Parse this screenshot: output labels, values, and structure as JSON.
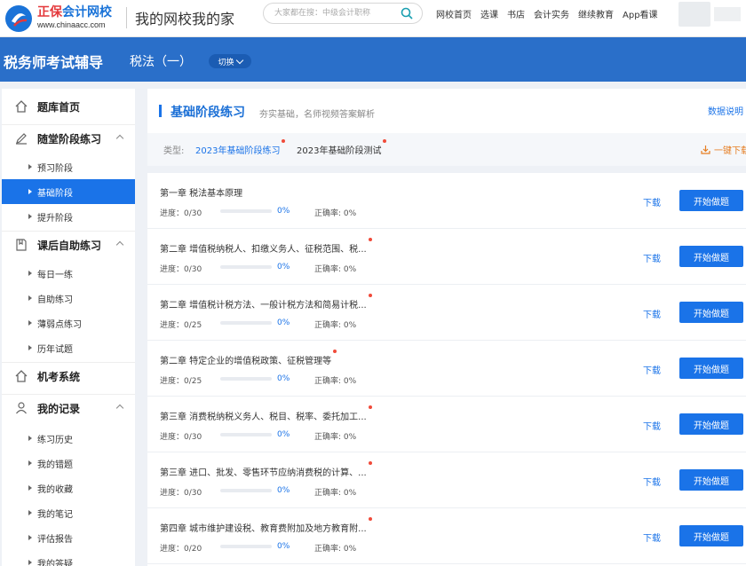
{
  "header": {
    "logo_brand": "正保",
    "logo_name": "会计网校",
    "logo_url": "www.chinaacc.com",
    "slogan": "我的网校我的家",
    "search_placeholder": "大家都在搜：中级会计职称",
    "nav": [
      "网校首页",
      "选课",
      "书店",
      "会计实务",
      "继续教育",
      "App看课"
    ]
  },
  "banner": {
    "title": "税务师考试辅导",
    "subject": "税法（一）",
    "switch_label": "切换"
  },
  "sidebar": {
    "groups": [
      {
        "label": "题库首页",
        "icon": "home-icon"
      },
      {
        "label": "随堂阶段练习",
        "icon": "pen-icon",
        "items": [
          "预习阶段",
          "基础阶段",
          "提升阶段"
        ]
      },
      {
        "label": "课后自助练习",
        "icon": "book-icon",
        "items": [
          "每日一练",
          "自助练习",
          "薄弱点练习",
          "历年试题"
        ]
      },
      {
        "label": "机考系统",
        "icon": "home-icon"
      },
      {
        "label": "我的记录",
        "icon": "user-icon",
        "items": [
          "练习历史",
          "我的错题",
          "我的收藏",
          "我的笔记",
          "评估报告",
          "我的答疑"
        ]
      }
    ],
    "active_item": "基础阶段"
  },
  "main": {
    "title": "基础阶段练习",
    "subtitle": "夯实基础，名师视频答案解析",
    "help": "数据说明",
    "type_label": "类型:",
    "types": [
      "2023年基础阶段练习",
      "2023年基础阶段测试"
    ],
    "download_all": "一键下载",
    "progress_label": "进度：",
    "accuracy_label": "正确率: ",
    "download_label": "下载",
    "start_label": "开始做题"
  },
  "rows": [
    {
      "title": "第一章 税法基本原理",
      "progress": "0/30",
      "percent": "0%",
      "accuracy": "0%",
      "new": false
    },
    {
      "title": "第二章 增值税纳税人、扣缴义务人、征税范围、税...",
      "progress": "0/30",
      "percent": "0%",
      "accuracy": "0%",
      "new": true
    },
    {
      "title": "第二章 增值税计税方法、一般计税方法和简易计税...",
      "progress": "0/25",
      "percent": "0%",
      "accuracy": "0%",
      "new": true
    },
    {
      "title": "第二章 特定企业的增值税政策、征税管理等",
      "progress": "0/25",
      "percent": "0%",
      "accuracy": "0%",
      "new": true
    },
    {
      "title": "第三章 消费税纳税义务人、税目、税率、委托加工...",
      "progress": "0/30",
      "percent": "0%",
      "accuracy": "0%",
      "new": true
    },
    {
      "title": "第三章 进口、批发、零售环节应纳消费税的计算、...",
      "progress": "0/30",
      "percent": "0%",
      "accuracy": "0%",
      "new": true
    },
    {
      "title": "第四章 城市维护建设税、教育费附加及地方教育附...",
      "progress": "0/20",
      "percent": "0%",
      "accuracy": "0%",
      "new": true
    }
  ],
  "colors": {
    "accent": "#1a73e8",
    "banner": "#2a6fc9",
    "dot": "#f04b3a",
    "download_all": "#e67e22"
  }
}
